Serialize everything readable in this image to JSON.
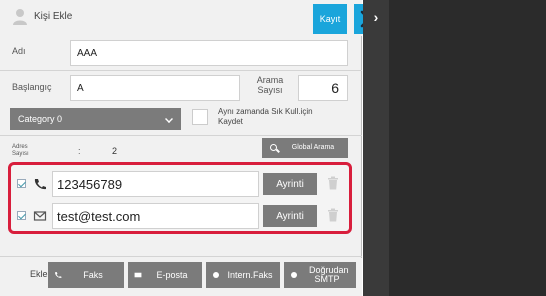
{
  "header": {
    "title": "Kişi Ekle",
    "save_label": "Kayıt"
  },
  "form": {
    "name_label": "Adı",
    "name_value": "AAA",
    "initial_label": "Başlangıç",
    "initial_value": "A",
    "search_count_label": "Arama Sayısı",
    "search_count_value": "6",
    "category_value": "Category 0",
    "frequent_label": "Aynı zamanda Sık Kull.için Kaydet"
  },
  "addresses": {
    "count_label": "Adres Sayısı",
    "count_colon": ":",
    "count_value": "2",
    "global_search_label": "Global Arama",
    "rows": [
      {
        "type_icon": "phone-icon",
        "value": "123456789",
        "detail_label": "Ayrinti"
      },
      {
        "type_icon": "envelope-icon",
        "value": "test@test.com",
        "detail_label": "Ayrinti"
      }
    ]
  },
  "add_bar": {
    "label": "Ekle",
    "buttons": [
      {
        "icon": "phone-icon",
        "label": "Faks"
      },
      {
        "icon": "envelope-icon",
        "label": "E-posta"
      },
      {
        "icon": "dot-icon",
        "label": "Intern.Faks"
      },
      {
        "icon": "dot-icon",
        "label": "Doğrudan SMTP"
      }
    ]
  },
  "colors": {
    "accent": "#1aa5db",
    "highlight": "#d81e3c",
    "button_gray": "#7b7b7b"
  }
}
